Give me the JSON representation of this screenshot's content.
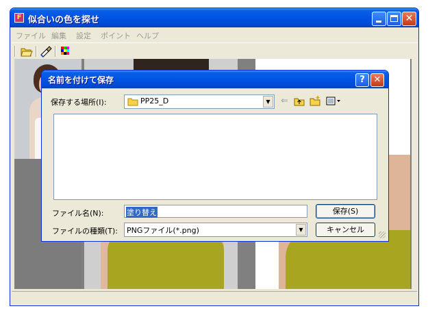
{
  "window": {
    "title": "似合いの色を探せ",
    "app_icon_letter": "F",
    "menu": [
      "ファイル",
      "編集",
      "設定",
      "ポイント",
      "ヘルプ"
    ],
    "toolbar_icons": [
      "open-folder-icon",
      "brush-icon",
      "color-palette-icon"
    ]
  },
  "dialog": {
    "title": "名前を付けて保存",
    "save_in_label": "保存する場所(I):",
    "save_in_value": "PP25_D",
    "nav_icons": [
      "back-arrow-icon",
      "up-folder-icon",
      "new-folder-icon",
      "view-menu-icon"
    ],
    "filename_label": "ファイル名(N):",
    "filename_value": "塗り替え",
    "filetype_label": "ファイルの種類(T):",
    "filetype_value": "PNGファイル(*.png)",
    "save_button": "保存(S)",
    "cancel_button": "キャンセル",
    "help_glyph": "?",
    "close_glyph": "✕"
  },
  "colors": {
    "titlebar": "#0054e3",
    "window_bg": "#ece9d8",
    "dress": "#a8a520",
    "selection": "#316ac5"
  }
}
